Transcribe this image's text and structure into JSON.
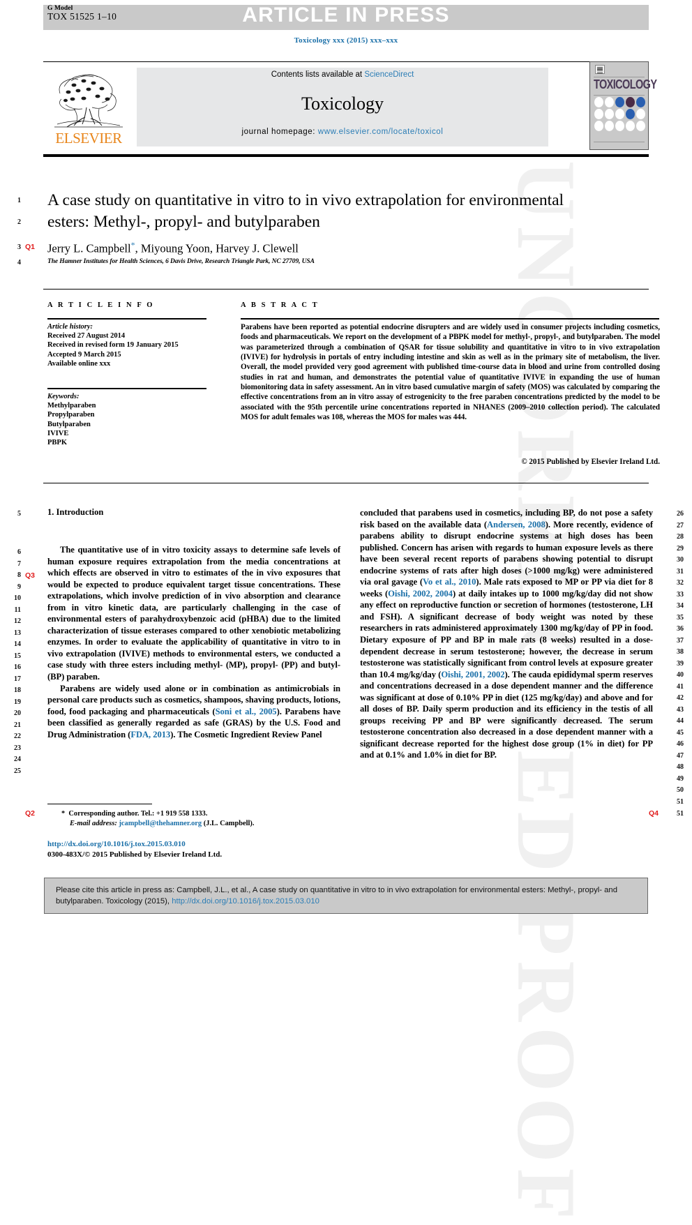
{
  "header": {
    "g_model_label": "G Model",
    "g_model_id": "TOX 51525 1–10",
    "article_in_press": "ARTICLE IN PRESS",
    "journal_ref": "Toxicology xxx (2015) xxx–xxx"
  },
  "masthead": {
    "contents_prefix": "Contents lists available at ",
    "contents_link": "ScienceDirect",
    "journal_title": "Toxicology",
    "homepage_prefix": "journal homepage: ",
    "homepage_link": "www.elsevier.com/locate/toxicol",
    "publisher_wordmark": "ELSEVIER",
    "cover_title": "TOXICOLOGY"
  },
  "article": {
    "title": "A case study on quantitative in vitro to in vivo extrapolation for environmental esters: Methyl-, propyl- and butylparaben",
    "authors": "Jerry L. Campbell",
    "authors_rest": ", Miyoung Yoon, Harvey J. Clewell",
    "author_marker": "*",
    "affiliation": "The Hamner Institutes for Health Sciences, 6 Davis Drive, Research Triangle Park, NC 27709, USA"
  },
  "info": {
    "heading": "A R T I C L E   I N F O",
    "history_label": "Article history:",
    "history": [
      "Received 27 August 2014",
      "Received in revised form 19 January 2015",
      "Accepted 9 March 2015",
      "Available online xxx"
    ],
    "keywords_label": "Keywords:",
    "keywords": [
      "Methylparaben",
      "Propylparaben",
      "Butylparaben",
      "IVIVE",
      "PBPK"
    ]
  },
  "abstract": {
    "heading": "A B S T R A C T",
    "text": "Parabens have been reported as potential endocrine disrupters and are widely used in consumer projects including cosmetics, foods and pharmaceuticals. We report on the development of a PBPK model for methyl-, propyl-, and butylparaben. The model was parameterized through a combination of QSAR for tissue solubility and quantitative in vitro to in vivo extrapolation (IVIVE) for hydrolysis in portals of entry including intestine and skin as well as in the primary site of metabolism, the liver. Overall, the model provided very good agreement with published time-course data in blood and urine from controlled dosing studies in rat and human, and demonstrates the potential value of quantitative IVIVE in expanding the use of human biomonitoring data in safety assessment. An in vitro based cumulative margin of safety (MOS) was calculated by comparing the effective concentrations from an in vitro assay of estrogenicity to the free paraben concentrations predicted by the model to be associated with the 95th percentile urine concentrations reported in NHANES (2009–2010 collection period). The calculated MOS for adult females was 108, whereas the MOS for males was 444.",
    "copyright": "© 2015 Published by Elsevier Ireland Ltd."
  },
  "body": {
    "section_title": "1. Introduction",
    "left_paragraph_1": "The quantitative use of in vitro toxicity assays to determine safe levels of human exposure requires extrapolation from the media concentrations at which effects are observed in vitro to estimates of the in vivo exposures that would be expected to produce equivalent target tissue concentrations. These extrapolations, which involve prediction of in vivo absorption and clearance from in vitro kinetic data, are particularly challenging in the case of environmental esters of parahydroxybenzoic acid (pHBA) due to the limited characterization of tissue esterases compared to other xenobiotic metabolizing enzymes. In order to evaluate the applicability of quantitative in vitro to in vivo extrapolation (IVIVE) methods to environmental esters, we conducted a case study with three esters including methyl- (MP), propyl- (PP) and butyl- (BP) paraben.",
    "left_paragraph_2_a": "Parabens are widely used alone or in combination as antimicrobials in personal care products such as cosmetics, shampoos, shaving products, lotions, food, food packaging and pharmaceuticals (",
    "left_ref_1": "Soni et al., 2005",
    "left_paragraph_2_b": "). Parabens have been classified as generally regarded as safe (GRAS) by the U.S. Food and Drug Administration (",
    "left_ref_2": "FDA, 2013",
    "left_paragraph_2_c": "). The Cosmetic Ingredient Review Panel",
    "right_paragraph_a": "concluded that parabens used in cosmetics, including BP, do not pose a safety risk based on the available data (",
    "right_ref_1": "Andersen, 2008",
    "right_paragraph_b": "). More recently, evidence of parabens ability to disrupt endocrine systems at high doses has been published. Concern has arisen with regards to human exposure levels as there have been several recent reports of parabens showing potential to disrupt endocrine systems of rats after high doses (>1000 mg/kg) were administered via oral gavage (",
    "right_ref_2": "Vo et al., 2010",
    "right_paragraph_c": "). Male rats exposed to MP or PP via diet for 8 weeks (",
    "right_ref_3": "Oishi, 2002, 2004",
    "right_paragraph_d": ") at daily intakes up to 1000 mg/kg/day did not show any effect on reproductive function or secretion of hormones (testosterone, LH and FSH). A significant decrease of body weight was noted by these researchers in rats administered approximately 1300 mg/kg/day of PP in food. Dietary exposure of PP and BP in male rats (8 weeks) resulted in a dose-dependent decrease in serum testosterone; however, the decrease in serum testosterone was statistically significant from control levels at exposure greater than 10.4 mg/kg/day (",
    "right_ref_4": "Oishi, 2001, 2002",
    "right_paragraph_e": "). The cauda epididymal sperm reserves and concentrations decreased in a dose dependent manner and the difference was significant at dose of 0.10% PP in diet (125 mg/kg/day) and above and for all doses of BP. Daily sperm production and its efficiency in the testis of all groups receiving PP and BP were significantly decreased. The serum testosterone concentration also decreased in a dose dependent manner with a significant decrease reported for the highest dose group (1% in diet) for PP and at 0.1% and 1.0% in diet for BP."
  },
  "footnotes": {
    "corresponding_marker": "*",
    "corresponding": "Corresponding author. Tel.: +1 919 558 1333.",
    "email_label": "E-mail address:",
    "email": "jcampbell@thehamner.org",
    "email_suffix": "(J.L. Campbell).",
    "doi": "http://dx.doi.org/10.1016/j.tox.2015.03.010",
    "issn_line": "0300-483X/© 2015 Published by Elsevier Ireland Ltd."
  },
  "citation_box": {
    "text_a": "Please cite this article in press as: Campbell, J.L., et al., A case study on quantitative in vitro to in vivo extrapolation for environmental esters: Methyl-, propyl- and butylparaben. Toxicology (2015), ",
    "link": "http://dx.doi.org/10.1016/j.tox.2015.03.010"
  },
  "line_numbers": {
    "title_area": [
      "1",
      "2",
      "3",
      "4"
    ],
    "left_column": [
      "5",
      "6",
      "7",
      "8",
      "9",
      "10",
      "11",
      "12",
      "13",
      "14",
      "15",
      "16",
      "17",
      "18",
      "19",
      "20",
      "21",
      "22",
      "23",
      "24",
      "25"
    ],
    "right_column": [
      "26",
      "27",
      "28",
      "29",
      "30",
      "31",
      "32",
      "33",
      "34",
      "35",
      "36",
      "37",
      "38",
      "39",
      "40",
      "41",
      "42",
      "43",
      "44",
      "45",
      "46",
      "47",
      "48",
      "49",
      "50",
      "51"
    ]
  },
  "query_tags": {
    "q1": "Q1",
    "q2": "Q2",
    "q3": "Q3",
    "q4": "Q4"
  },
  "watermark": {
    "text": "UNCORRECTED PROOF"
  },
  "colors": {
    "link": "#2b7db5",
    "reference_link": "#1a6fa8",
    "query_tag": "#e01b1b",
    "band_gray": "#c9c9c9",
    "contents_gray": "#e6e7e8",
    "elsevier_orange": "#E8851A"
  }
}
